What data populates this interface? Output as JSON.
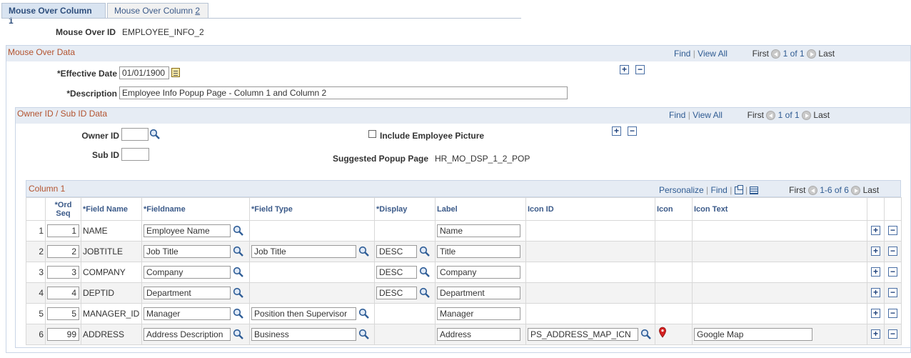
{
  "tabs": [
    {
      "label": "Mouse Over Column 1",
      "active": true
    },
    {
      "label": "Mouse Over Column ",
      "underline": "2",
      "active": false
    }
  ],
  "mouse_over_id": {
    "label": "Mouse Over ID",
    "value": "EMPLOYEE_INFO_2"
  },
  "mouse_over_data": {
    "title": "Mouse Over Data",
    "find": "Find",
    "view_all": "View All",
    "first": "First",
    "range": "1 of 1",
    "last": "Last",
    "effective_date_label": "*Effective Date",
    "effective_date": "01/01/1900",
    "description_label": "*Description",
    "description": "Employee Info Popup Page - Column 1 and Column 2"
  },
  "owner_data": {
    "title": "Owner ID / Sub ID Data",
    "find": "Find",
    "view_all": "View All",
    "first": "First",
    "range": "1 of 1",
    "last": "Last",
    "owner_id_label": "Owner ID",
    "owner_id": "",
    "sub_id_label": "Sub ID",
    "sub_id": "",
    "include_picture_label": "Include Employee Picture",
    "include_picture": false,
    "suggested_label": "Suggested Popup Page",
    "suggested_value": "HR_MO_DSP_1_2_POP"
  },
  "column1": {
    "title": "Column 1",
    "personalize": "Personalize",
    "find": "Find",
    "first": "First",
    "range": "1-6 of 6",
    "last": "Last",
    "headers": [
      "",
      "*Ord Seq",
      "*Field Name",
      "*Fieldname",
      "*Field Type",
      "*Display",
      "Label",
      "Icon ID",
      "Icon",
      "Icon Text",
      "",
      ""
    ],
    "rows": [
      {
        "n": "1",
        "seq": "1",
        "field_name": "NAME",
        "fieldname": "Employee Name",
        "field_type": "",
        "display": "",
        "label": "Name",
        "icon_id": "",
        "icon": false,
        "icon_text": ""
      },
      {
        "n": "2",
        "seq": "2",
        "field_name": "JOBTITLE",
        "fieldname": "Job Title",
        "field_type": "Job Title",
        "display": "DESC",
        "label": "Title",
        "icon_id": "",
        "icon": false,
        "icon_text": ""
      },
      {
        "n": "3",
        "seq": "3",
        "field_name": "COMPANY",
        "fieldname": "Company",
        "field_type": "",
        "display": "DESC",
        "label": "Company",
        "icon_id": "",
        "icon": false,
        "icon_text": ""
      },
      {
        "n": "4",
        "seq": "4",
        "field_name": "DEPTID",
        "fieldname": "Department",
        "field_type": "",
        "display": "DESC",
        "label": "Department",
        "icon_id": "",
        "icon": false,
        "icon_text": ""
      },
      {
        "n": "5",
        "seq": "5",
        "field_name": "MANAGER_ID",
        "fieldname": "Manager",
        "field_type": "Position then Supervisor",
        "display": "",
        "label": "Manager",
        "icon_id": "",
        "icon": false,
        "icon_text": ""
      },
      {
        "n": "6",
        "seq": "99",
        "field_name": "ADDRESS",
        "fieldname": "Address Description",
        "field_type": "Business",
        "display": "",
        "label": "Address",
        "icon_id": "PS_ADDRESS_MAP_ICN",
        "icon": true,
        "icon_text": "Google Map"
      }
    ]
  },
  "colors": {
    "tab_active": "#d9e4f1",
    "section_head": "#e6ecf4",
    "section_title": "#b3532f",
    "link": "#2f5b92"
  }
}
